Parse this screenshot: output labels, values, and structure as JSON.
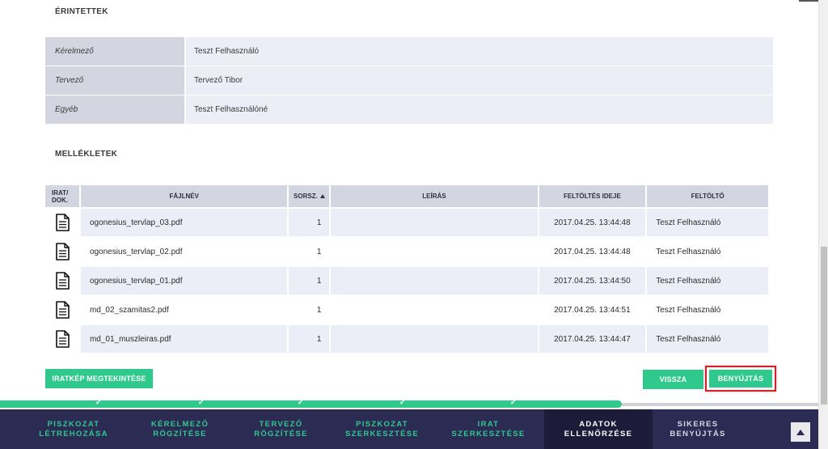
{
  "parties": {
    "title": "ÉRINTETTEK",
    "rows": [
      {
        "label": "Kérelmező",
        "value": "Teszt Felhasználó"
      },
      {
        "label": "Tervező",
        "value": "Tervező Tibor"
      },
      {
        "label": "Egyéb",
        "value": "Teszt Felhasználóné"
      }
    ]
  },
  "attachments": {
    "title": "MELLÉKLETEK",
    "headers": {
      "icon_line1": "IRAT/",
      "icon_line2": "DOK.",
      "filename": "FÁJLNÉV",
      "sorsz": "SORSZ.",
      "description": "LEÍRÁS",
      "upload_date": "FELTÖLTÉS IDEJE",
      "uploader": "FELTÖLTŐ"
    },
    "rows": [
      {
        "icon": "document-icon",
        "filename": "ogonesius_tervlap_03.pdf",
        "sorsz": "1",
        "description": "",
        "upload_date": "2017.04.25. 13:44:48",
        "uploader": "Teszt Felhasználó"
      },
      {
        "icon": "document-icon",
        "filename": "ogonesius_tervlap_02.pdf",
        "sorsz": "1",
        "description": "",
        "upload_date": "2017.04.25. 13:44:48",
        "uploader": "Teszt Felhasználó"
      },
      {
        "icon": "document-icon",
        "filename": "ogonesius_tervlap_01.pdf",
        "sorsz": "1",
        "description": "",
        "upload_date": "2017.04.25. 13:44:50",
        "uploader": "Teszt Felhasználó"
      },
      {
        "icon": "document-icon",
        "filename": "md_02_szamitas2.pdf",
        "sorsz": "1",
        "description": "",
        "upload_date": "2017.04.25. 13:44:51",
        "uploader": "Teszt Felhasználó"
      },
      {
        "icon": "document-icon",
        "filename": "md_01_muszleiras.pdf",
        "sorsz": "1",
        "description": "",
        "upload_date": "2017.04.25. 13:44:47",
        "uploader": "Teszt Felhasználó"
      }
    ]
  },
  "actions": {
    "view_document": "IRATKÉP MEGTEKINTÉSE",
    "back": "VISSZA",
    "submit": "BENYÚJTÁS"
  },
  "progress": {
    "completed_steps": 5,
    "total_steps": 8,
    "fill_fraction": 0.76
  },
  "steps": [
    {
      "line1": "PISZKOZAT",
      "line2": "LÉTREHOZÁSA",
      "state": "done"
    },
    {
      "line1": "KÉRELMEZŐ",
      "line2": "RÖGZÍTÉSE",
      "state": "done"
    },
    {
      "line1": "TERVEZŐ",
      "line2": "RÖGZÍTÉSE",
      "state": "done"
    },
    {
      "line1": "PISZKOZAT",
      "line2": "SZERKESZTÉSE",
      "state": "done"
    },
    {
      "line1": "IRAT",
      "line2": "SZERKESZTÉSE",
      "state": "done"
    },
    {
      "line1": "ADATOK",
      "line2": "ELLENŐRZÉSE",
      "state": "active"
    },
    {
      "line1": "SIKERES",
      "line2": "BENYÚJTÁS",
      "state": "pending"
    }
  ],
  "colors": {
    "accent": "#2fc98e",
    "nav_bg": "#2b2b54",
    "nav_active_bg": "#1c1c3a",
    "highlight_border": "#d0202a"
  },
  "icons": {
    "check": "✔",
    "scroll_top": "arrow-up-icon"
  }
}
